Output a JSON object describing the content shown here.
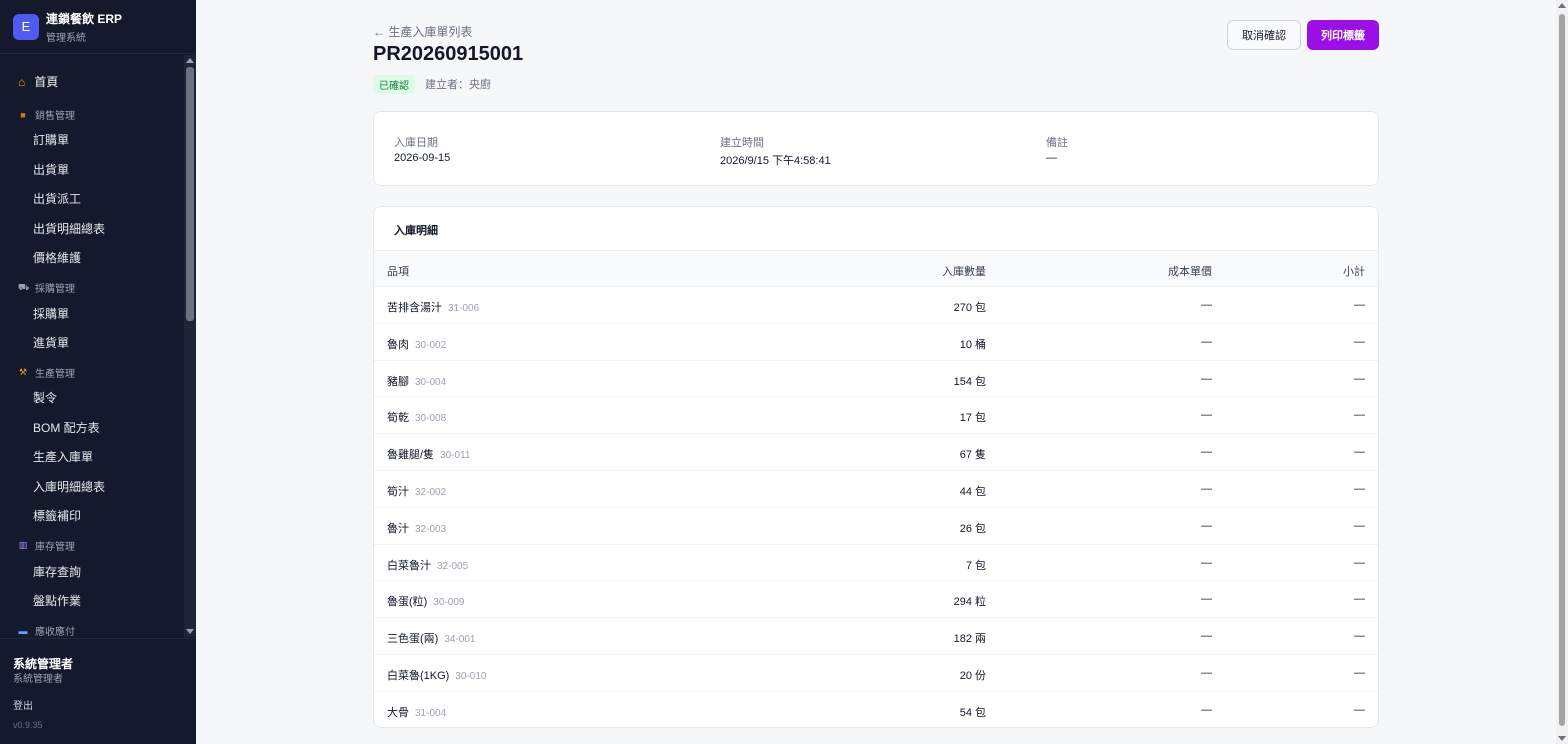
{
  "brand": {
    "logo_letter": "E",
    "title": "連鎖餐飲 ERP",
    "subtitle": "管理系統",
    "logo_color": "#4f5bf0"
  },
  "sidebar": {
    "home": {
      "icon": "home-icon",
      "label": "首頁"
    },
    "sections": [
      {
        "icon": "box-icon",
        "label": "銷售管理",
        "items": [
          "訂購單",
          "出貨單",
          "出貨派工",
          "出貨明細總表",
          "價格維護"
        ]
      },
      {
        "icon": "cart-icon",
        "label": "採購管理",
        "items": [
          "採購單",
          "進貨單"
        ]
      },
      {
        "icon": "factory-icon",
        "label": "生產管理",
        "items": [
          "製令",
          "BOM 配方表",
          "生產入庫單",
          "入庫明細總表",
          "標籤補印"
        ]
      },
      {
        "icon": "warehouse-icon",
        "label": "庫存管理",
        "items": [
          "庫存查詢",
          "盤點作業"
        ]
      },
      {
        "icon": "card-icon",
        "label": "應收應付",
        "items": []
      }
    ],
    "user": {
      "name": "系統管理者",
      "role": "系統管理者"
    },
    "logout_label": "登出",
    "version": "v0.9.35"
  },
  "header": {
    "back_link": "← 生產入庫單列表",
    "title": "PR20260915001",
    "status": "已確認",
    "creator": "建立者：央廚",
    "cancel_button": "取消確認",
    "print_button": "列印標籤"
  },
  "info": {
    "date_label": "入庫日期",
    "date_value": "2026-09-15",
    "created_label": "建立時間",
    "created_value": "2026/9/15 下午4:58:41",
    "note_label": "備註",
    "note_value": "—"
  },
  "details": {
    "title": "入庫明細",
    "columns": [
      "品項",
      "入庫數量",
      "成本單價",
      "小計"
    ],
    "rows": [
      {
        "name": "苦排含湯汁",
        "code": "31-006",
        "qty": "270 包",
        "cost": "—",
        "subtotal": "—"
      },
      {
        "name": "魯肉",
        "code": "30-002",
        "qty": "10 桶",
        "cost": "—",
        "subtotal": "—"
      },
      {
        "name": "豬腳",
        "code": "30-004",
        "qty": "154 包",
        "cost": "—",
        "subtotal": "—"
      },
      {
        "name": "筍乾",
        "code": "30-008",
        "qty": "17 包",
        "cost": "—",
        "subtotal": "—"
      },
      {
        "name": "魯雞腿/隻",
        "code": "30-011",
        "qty": "67 隻",
        "cost": "—",
        "subtotal": "—"
      },
      {
        "name": "筍汁",
        "code": "32-002",
        "qty": "44 包",
        "cost": "—",
        "subtotal": "—"
      },
      {
        "name": "魯汁",
        "code": "32-003",
        "qty": "26 包",
        "cost": "—",
        "subtotal": "—"
      },
      {
        "name": "白菜魯汁",
        "code": "32-005",
        "qty": "7 包",
        "cost": "—",
        "subtotal": "—"
      },
      {
        "name": "魯蛋(粒)",
        "code": "30-009",
        "qty": "294 粒",
        "cost": "—",
        "subtotal": "—"
      },
      {
        "name": "三色蛋(兩)",
        "code": "34-001",
        "qty": "182 兩",
        "cost": "—",
        "subtotal": "—"
      },
      {
        "name": "白菜魯(1KG)",
        "code": "30-010",
        "qty": "20 份",
        "cost": "—",
        "subtotal": "—"
      },
      {
        "name": "大骨",
        "code": "31-004",
        "qty": "54 包",
        "cost": "—",
        "subtotal": "—"
      }
    ]
  },
  "colors": {
    "sidebar_bg": "#141a2b",
    "accent": "#9b0ee6",
    "status_bg": "#dcfce7",
    "status_text": "#15803d"
  }
}
